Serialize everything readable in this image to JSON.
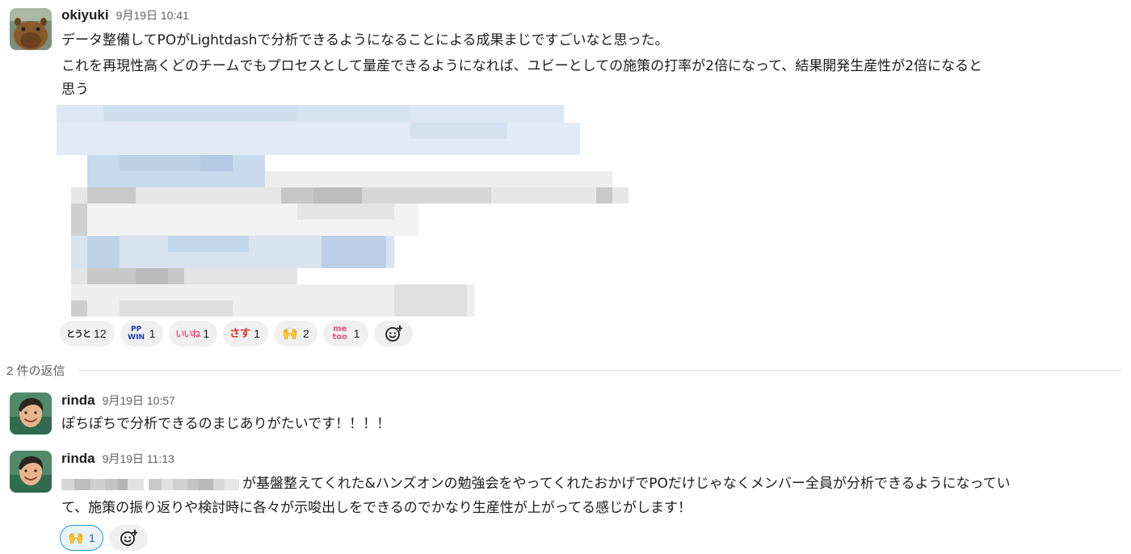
{
  "thread": {
    "parent": {
      "author": "okiyuki",
      "time": "9月19日 10:41",
      "lines": [
        "データ整備してPOがLightdashで分析できるようになることによる成果まじですごいなと思った。",
        "これを再現性高くどのチームでもプロセスとして量産できるようになれば、ユビーとしての施策の打率が2倍になって、結果開発生産性が2倍になると",
        "思う"
      ],
      "attachment": "pixelated-image-icon",
      "reactions": [
        {
          "emoji_text": "とうと",
          "emoji_icon": "toutoi-emoji",
          "count": "12",
          "color": "#222222"
        },
        {
          "emoji_text": "PP WIN",
          "emoji_icon": "pp-win-emoji",
          "count": "1",
          "color": "#1a3fb5"
        },
        {
          "emoji_text": "いいね",
          "emoji_icon": "iine-emoji",
          "count": "1",
          "color": "#e0517b"
        },
        {
          "emoji_text": "さす",
          "emoji_icon": "sasu-emoji",
          "count": "1",
          "color": "#d93025"
        },
        {
          "emoji_text": "🙌",
          "emoji_icon": "raised-hands-emoji",
          "count": "2",
          "color": "#f5b400"
        },
        {
          "emoji_text": "me too",
          "emoji_icon": "me-too-emoji",
          "count": "1",
          "color": "#e0517b"
        }
      ],
      "add_reaction_icon": "add-reaction-icon"
    },
    "reply_divider": "2 件の返信",
    "replies": [
      {
        "author": "rinda",
        "time": "9月19日 10:57",
        "lines": [
          "ぽちぽちで分析できるのまじありがたいです！！！！"
        ]
      },
      {
        "author": "rinda",
        "time": "9月19日 11:13",
        "lines": [
          "が基盤整えてくれた&ハンズオンの勉強会をやってくれたおかげでPOだけじゃなくメンバー全員が分析できるようになってい",
          "て、施策の振り返りや検討時に各々が示唆出しをできるのでかなり生産性が上がってる感じがします！"
        ],
        "reactions": [
          {
            "emoji_text": "🙌",
            "emoji_icon": "raised-hands-emoji",
            "count": "1",
            "color": "#f5b400"
          }
        ],
        "add_reaction_icon": "add-reaction-icon"
      }
    ]
  }
}
